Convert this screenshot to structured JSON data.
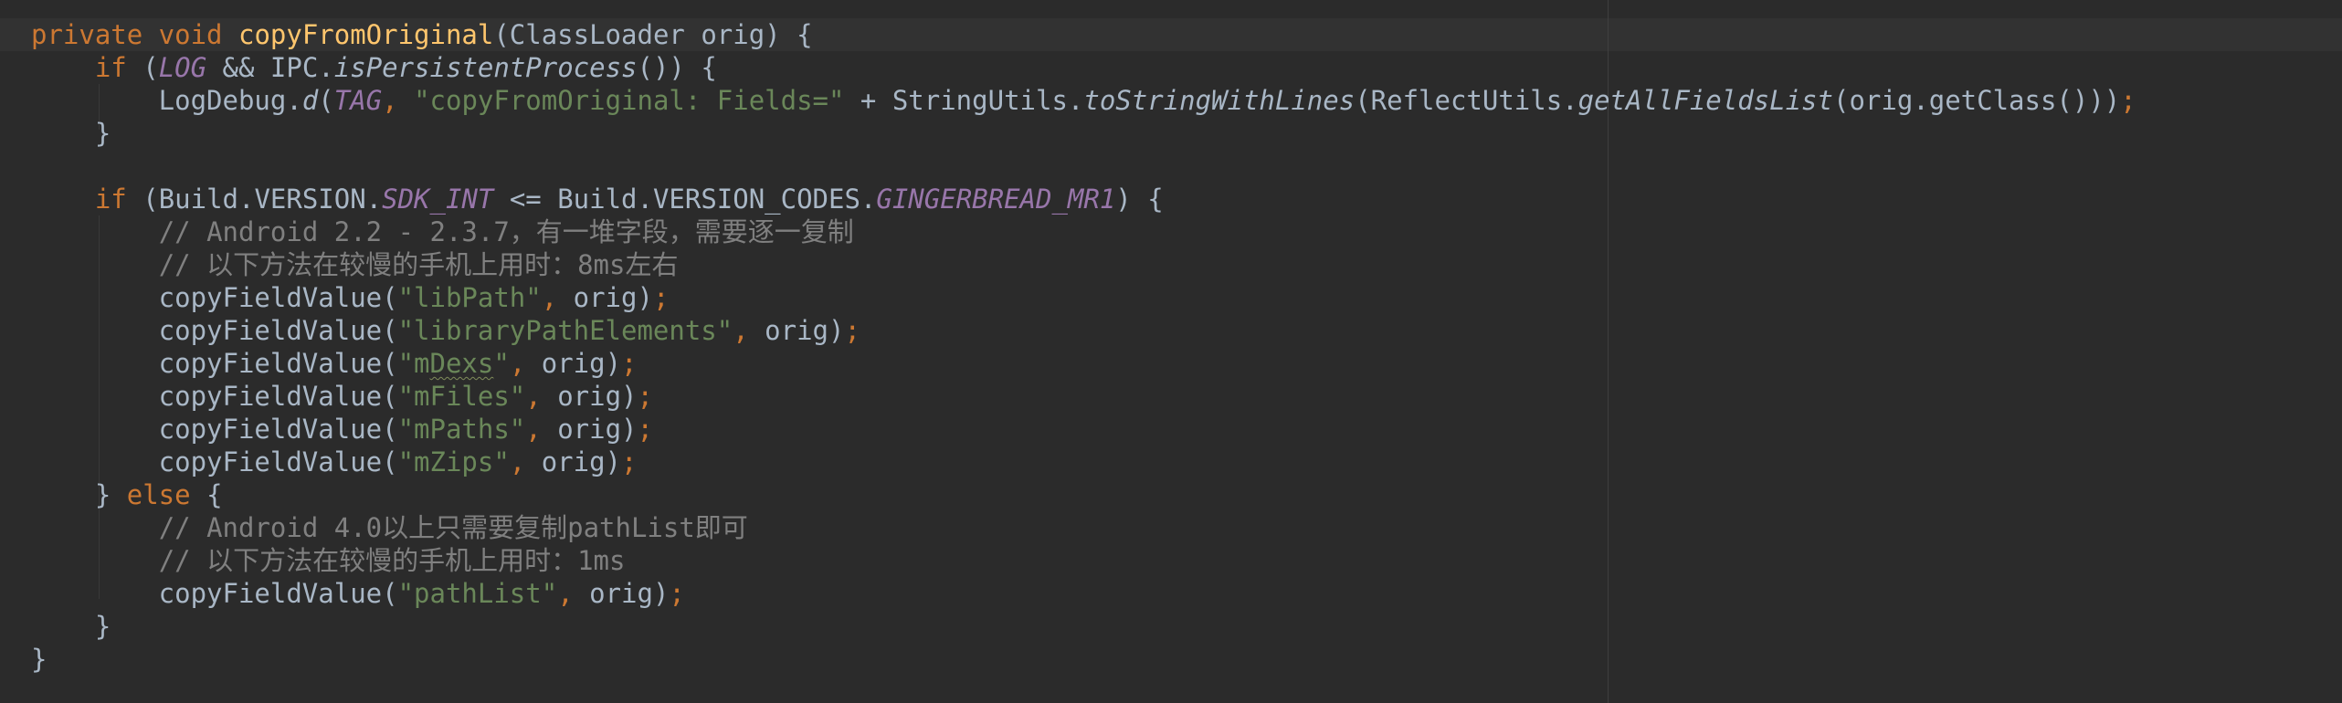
{
  "editor": {
    "theme_colors": {
      "background": "#2b2b2b",
      "keyword": "#cc7832",
      "method_declaration": "#ffc66d",
      "plain_text": "#a9b7c6",
      "string": "#6a8759",
      "comment": "#808080",
      "constant": "#9876aa"
    },
    "lines": [
      {
        "tokens": [
          {
            "text": "private void ",
            "cls": "kw"
          },
          {
            "text": "copyFromOriginal",
            "cls": "fn"
          },
          {
            "text": "(ClassLoader orig) {",
            "cls": "pn"
          }
        ]
      },
      {
        "tokens": [
          {
            "text": "    ",
            "cls": "pn"
          },
          {
            "text": "if ",
            "cls": "kw"
          },
          {
            "text": "(",
            "cls": "pn"
          },
          {
            "text": "LOG",
            "cls": "cn"
          },
          {
            "text": " && IPC.",
            "cls": "pn"
          },
          {
            "text": "isPersistentProcess",
            "cls": "pn it"
          },
          {
            "text": "()) {",
            "cls": "pn"
          }
        ]
      },
      {
        "tokens": [
          {
            "text": "        LogDebug.",
            "cls": "pn"
          },
          {
            "text": "d",
            "cls": "pn it"
          },
          {
            "text": "(",
            "cls": "pn"
          },
          {
            "text": "TAG",
            "cls": "cn"
          },
          {
            "text": ", ",
            "cls": "sc"
          },
          {
            "text": "\"copyFromOriginal: Fields=\"",
            "cls": "st"
          },
          {
            "text": " + StringUtils.",
            "cls": "pn"
          },
          {
            "text": "toStringWithLines",
            "cls": "pn it"
          },
          {
            "text": "(ReflectUtils.",
            "cls": "pn"
          },
          {
            "text": "getAllFieldsList",
            "cls": "pn it"
          },
          {
            "text": "(orig.getClass()))",
            "cls": "pn"
          },
          {
            "text": ";",
            "cls": "sc"
          }
        ]
      },
      {
        "tokens": [
          {
            "text": "    }",
            "cls": "pn"
          }
        ]
      },
      {
        "tokens": []
      },
      {
        "tokens": [
          {
            "text": "    ",
            "cls": "pn"
          },
          {
            "text": "if ",
            "cls": "kw"
          },
          {
            "text": "(Build.VERSION.",
            "cls": "pn"
          },
          {
            "text": "SDK_INT",
            "cls": "cn"
          },
          {
            "text": " <= Build.VERSION_CODES.",
            "cls": "pn"
          },
          {
            "text": "GINGERBREAD_MR1",
            "cls": "cn"
          },
          {
            "text": ") {",
            "cls": "pn"
          }
        ]
      },
      {
        "tokens": [
          {
            "text": "        ",
            "cls": "pn"
          },
          {
            "text": "// Android 2.2 - 2.3.7，有一堆字段，需要逐一复制",
            "cls": "cm"
          }
        ]
      },
      {
        "tokens": [
          {
            "text": "        ",
            "cls": "pn"
          },
          {
            "text": "// 以下方法在较慢的手机上用时：8ms左右",
            "cls": "cm"
          }
        ]
      },
      {
        "tokens": [
          {
            "text": "        copyFieldValue(",
            "cls": "pn"
          },
          {
            "text": "\"libPath\"",
            "cls": "st"
          },
          {
            "text": ", ",
            "cls": "sc"
          },
          {
            "text": "orig)",
            "cls": "pn"
          },
          {
            "text": ";",
            "cls": "sc"
          }
        ]
      },
      {
        "tokens": [
          {
            "text": "        copyFieldValue(",
            "cls": "pn"
          },
          {
            "text": "\"libraryPathElements\"",
            "cls": "st"
          },
          {
            "text": ", ",
            "cls": "sc"
          },
          {
            "text": "orig)",
            "cls": "pn"
          },
          {
            "text": ";",
            "cls": "sc"
          }
        ]
      },
      {
        "tokens": [
          {
            "text": "        copyFieldValue(",
            "cls": "pn"
          },
          {
            "text": "\"m",
            "cls": "st"
          },
          {
            "text": "Dexs",
            "cls": "st typo"
          },
          {
            "text": "\"",
            "cls": "st"
          },
          {
            "text": ", ",
            "cls": "sc"
          },
          {
            "text": "orig)",
            "cls": "pn"
          },
          {
            "text": ";",
            "cls": "sc"
          }
        ]
      },
      {
        "tokens": [
          {
            "text": "        copyFieldValue(",
            "cls": "pn"
          },
          {
            "text": "\"mFiles\"",
            "cls": "st"
          },
          {
            "text": ", ",
            "cls": "sc"
          },
          {
            "text": "orig)",
            "cls": "pn"
          },
          {
            "text": ";",
            "cls": "sc"
          }
        ]
      },
      {
        "tokens": [
          {
            "text": "        copyFieldValue(",
            "cls": "pn"
          },
          {
            "text": "\"mPaths\"",
            "cls": "st"
          },
          {
            "text": ", ",
            "cls": "sc"
          },
          {
            "text": "orig)",
            "cls": "pn"
          },
          {
            "text": ";",
            "cls": "sc"
          }
        ]
      },
      {
        "tokens": [
          {
            "text": "        copyFieldValue(",
            "cls": "pn"
          },
          {
            "text": "\"mZips\"",
            "cls": "st"
          },
          {
            "text": ", ",
            "cls": "sc"
          },
          {
            "text": "orig)",
            "cls": "pn"
          },
          {
            "text": ";",
            "cls": "sc"
          }
        ]
      },
      {
        "tokens": [
          {
            "text": "    } ",
            "cls": "pn"
          },
          {
            "text": "else ",
            "cls": "kw"
          },
          {
            "text": "{",
            "cls": "pn"
          }
        ]
      },
      {
        "tokens": [
          {
            "text": "        ",
            "cls": "pn"
          },
          {
            "text": "// Android 4.0以上只需要复制pathList即可",
            "cls": "cm"
          }
        ]
      },
      {
        "tokens": [
          {
            "text": "        ",
            "cls": "pn"
          },
          {
            "text": "// 以下方法在较慢的手机上用时：1ms",
            "cls": "cm"
          }
        ]
      },
      {
        "tokens": [
          {
            "text": "        copyFieldValue(",
            "cls": "pn"
          },
          {
            "text": "\"pathList\"",
            "cls": "st"
          },
          {
            "text": ", ",
            "cls": "sc"
          },
          {
            "text": "orig)",
            "cls": "pn"
          },
          {
            "text": ";",
            "cls": "sc"
          }
        ]
      },
      {
        "tokens": [
          {
            "text": "    }",
            "cls": "pn"
          }
        ]
      },
      {
        "tokens": [
          {
            "text": "}",
            "cls": "pn"
          }
        ]
      }
    ]
  }
}
